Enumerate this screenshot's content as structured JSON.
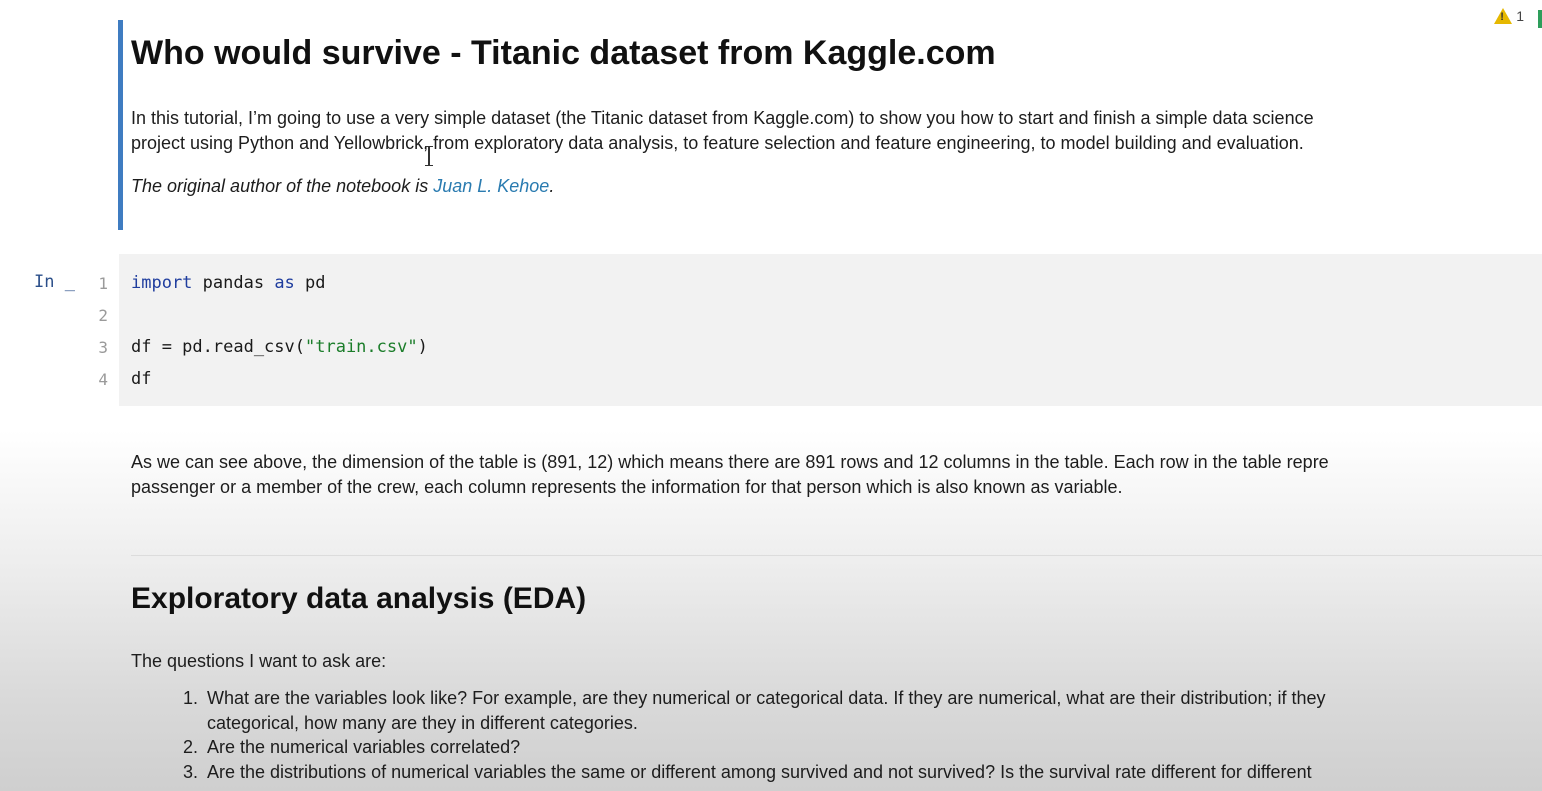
{
  "status": {
    "warning_count": "1"
  },
  "intro_cell": {
    "title": "Who would survive - Titanic dataset from Kaggle.com",
    "line1": "In this tutorial, I’m going to use a very simple dataset (the Titanic dataset from Kaggle.com) to show you how to start and finish a simple data science",
    "line2": "project using Python and Yellowbrick, from exploratory data analysis, to feature selection and feature engineering, to model building and evaluation.",
    "author_prefix": "The original author of the notebook is ",
    "author_name": "Juan L. Kehoe",
    "author_suffix": "."
  },
  "code_cell": {
    "prompt": "In _",
    "line_numbers": [
      "1",
      "2",
      "3",
      "4"
    ],
    "line1": {
      "kw1": "import",
      "mid": " pandas ",
      "kw2": "as",
      "end": " pd"
    },
    "line3": {
      "start": "df = pd.read_csv(",
      "string": "\"train.csv\"",
      "end": ")"
    },
    "line4": "df"
  },
  "explain_cell": {
    "line1": "As we can see above, the dimension of the table is (891, 12) which means there are 891 rows and 12 columns in the table. Each row in the table repre",
    "line2": "passenger or a member of the crew, each column represents the information for that person which is also known as variable."
  },
  "eda_cell": {
    "heading": "Exploratory data analysis (EDA)",
    "intro": "The questions I want to ask are:",
    "questions": [
      {
        "num": "1.",
        "line1": "What are the variables look like? For example, are they numerical or categorical data. If they are numerical, what are their distribution; if they",
        "line2": "categorical, how many are they in different categories."
      },
      {
        "num": "2.",
        "line1": "Are the numerical variables correlated?"
      },
      {
        "num": "3.",
        "line1": "Are the distributions of numerical variables the same or different among survived and not survived? Is the survival rate different for different"
      }
    ]
  },
  "colors": {
    "cell_marker": "#3f7cc1",
    "link": "#2a7bb0",
    "keyword": "#1f3d9e",
    "string": "#1b7d2a",
    "warning": "#e6b800"
  },
  "icons": [
    "warning-icon"
  ]
}
